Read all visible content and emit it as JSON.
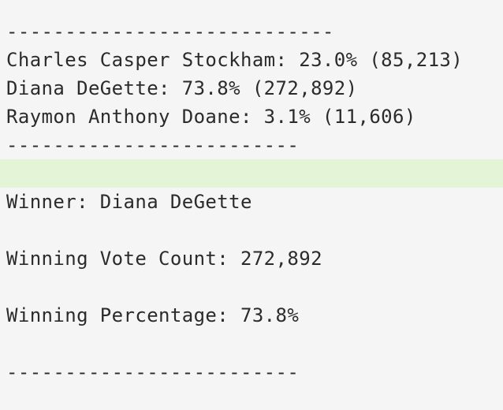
{
  "output": {
    "lines": [
      {
        "text": "----------------------------",
        "highlight": false
      },
      {
        "text": "Charles Casper Stockham: 23.0% (85,213)",
        "highlight": false
      },
      {
        "text": "Diana DeGette: 73.8% (272,892)",
        "highlight": false
      },
      {
        "text": "Raymon Anthony Doane: 3.1% (11,606)",
        "highlight": false
      },
      {
        "text": "-------------------------",
        "highlight": false
      },
      {
        "text": "",
        "highlight": true
      },
      {
        "text": "Winner: Diana DeGette",
        "highlight": false
      },
      {
        "text": "",
        "highlight": false
      },
      {
        "text": "Winning Vote Count: 272,892",
        "highlight": false
      },
      {
        "text": "",
        "highlight": false
      },
      {
        "text": "Winning Percentage: 73.8%",
        "highlight": false
      },
      {
        "text": "",
        "highlight": false
      },
      {
        "text": "-------------------------",
        "highlight": false
      }
    ]
  },
  "colors": {
    "background": "#f5f5f5",
    "text": "#2b2b2b",
    "highlight": "#e3f5d6"
  }
}
